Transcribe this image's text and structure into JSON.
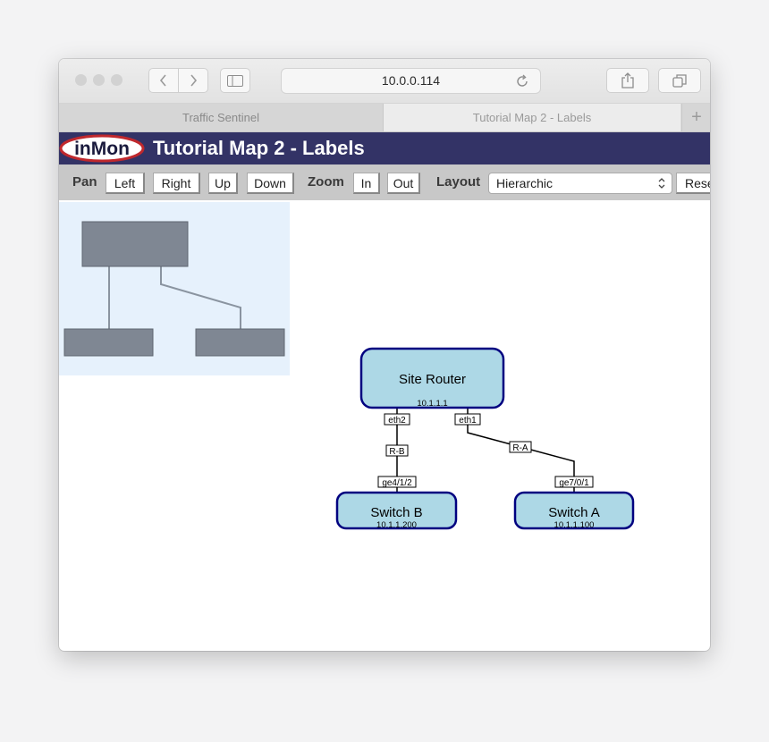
{
  "browser": {
    "address": "10.0.0.114",
    "tabs": [
      {
        "label": "Traffic Sentinel",
        "active": false
      },
      {
        "label": "Tutorial Map 2 - Labels",
        "active": true
      }
    ],
    "new_tab_label": "+"
  },
  "app": {
    "logo_text": "inMon",
    "title": "Tutorial Map 2 - Labels",
    "colors": {
      "banner": "#333366",
      "node_fill": "#add8e6",
      "node_border": "#000080",
      "overview_bg": "#e6f1fc"
    }
  },
  "toolbar": {
    "pan_label": "Pan",
    "pan_buttons": [
      "Left",
      "Right",
      "Up",
      "Down"
    ],
    "zoom_label": "Zoom",
    "zoom_buttons": [
      "In",
      "Out"
    ],
    "layout_label": "Layout",
    "layout_value": "Hierarchic",
    "reset_label": "Reset"
  },
  "map": {
    "nodes": [
      {
        "id": "router",
        "name": "Site Router",
        "ip": "10.1.1.1"
      },
      {
        "id": "switch_b",
        "name": "Switch B",
        "ip": "10.1.1.200"
      },
      {
        "id": "switch_a",
        "name": "Switch A",
        "ip": "10.1.1.100"
      }
    ],
    "links": [
      {
        "name": "R-B",
        "from": "router",
        "from_port": "eth2",
        "to": "switch_b",
        "to_port": "ge4/1/2"
      },
      {
        "name": "R-A",
        "from": "router",
        "from_port": "eth1",
        "to": "switch_a",
        "to_port": "ge7/0/1"
      }
    ]
  }
}
